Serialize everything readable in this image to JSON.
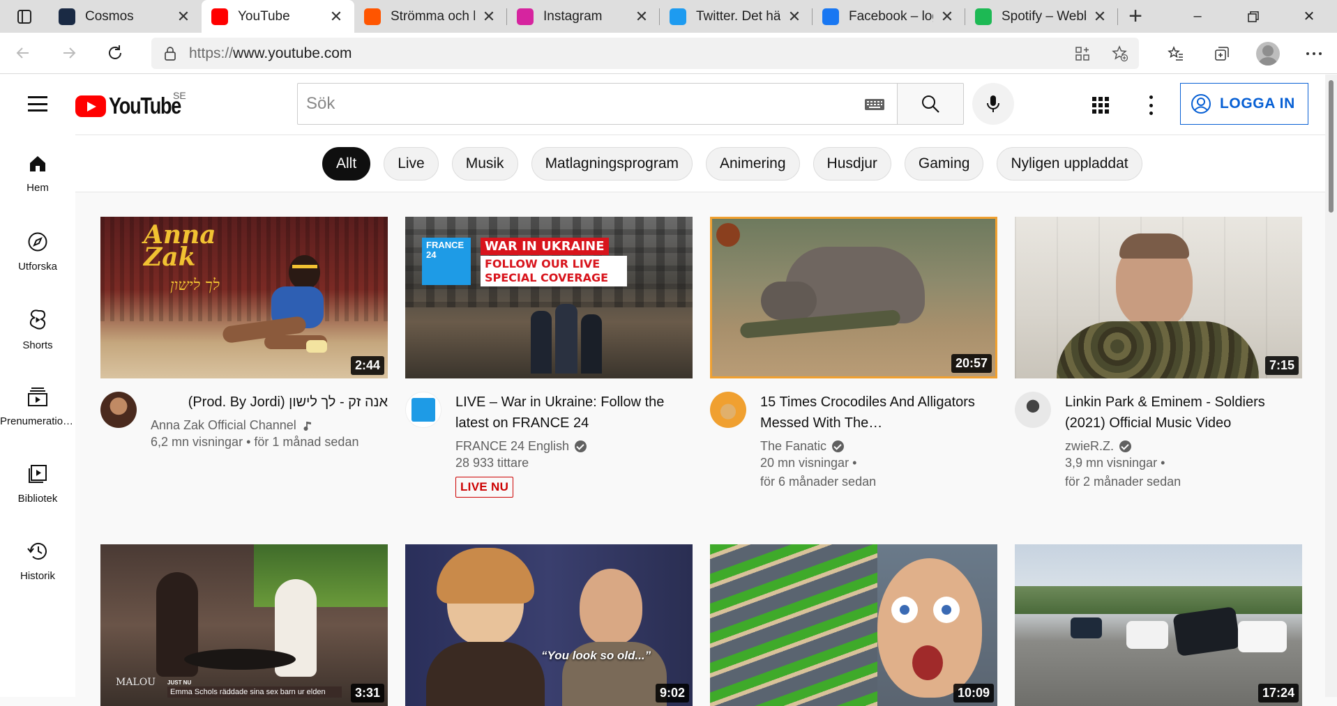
{
  "browser": {
    "tabs": [
      {
        "title": "Cosmos",
        "favicon": "cosmos-icon",
        "color": "#1a2a44"
      },
      {
        "title": "YouTube",
        "favicon": "youtube-icon",
        "color": "#ff0000"
      },
      {
        "title": "Strömma och ly",
        "favicon": "soundcloud-icon",
        "color": "#ff5500"
      },
      {
        "title": "Instagram",
        "favicon": "instagram-icon",
        "color": "#d6249f"
      },
      {
        "title": "Twitter. Det här",
        "favicon": "twitter-icon",
        "color": "#1d9bf0"
      },
      {
        "title": "Facebook – log",
        "favicon": "facebook-icon",
        "color": "#1877f2"
      },
      {
        "title": "Spotify – Webb",
        "favicon": "spotify-icon",
        "color": "#1db954"
      }
    ],
    "active_tab": 1,
    "url_protocol": "https://",
    "url_host": "www.youtube.com"
  },
  "youtube": {
    "logo_text": "YouTube",
    "country_code": "SE",
    "search_placeholder": "Sök",
    "login_label": "LOGGA IN",
    "sidebar": [
      {
        "label": "Hem",
        "icon": "home-icon"
      },
      {
        "label": "Utforska",
        "icon": "compass-icon"
      },
      {
        "label": "Shorts",
        "icon": "shorts-icon"
      },
      {
        "label": "Prenumerationer",
        "icon": "subscriptions-icon"
      },
      {
        "label": "Bibliotek",
        "icon": "library-icon"
      },
      {
        "label": "Historik",
        "icon": "history-icon"
      }
    ],
    "chips": [
      "Allt",
      "Live",
      "Musik",
      "Matlagningsprogram",
      "Animering",
      "Husdjur",
      "Gaming",
      "Nyligen uppladdat"
    ],
    "videos": [
      {
        "title": "אנה זק - לך לישון (Prod. By Jordi)",
        "channel": "Anna Zak Official Channel",
        "stats1": "6,2 mn visningar • för 1 månad sedan",
        "stats2": "",
        "duration": "2:44",
        "thumb_text": "Anna Zak",
        "thumb_subtext": "לך לישון",
        "music_note": true
      },
      {
        "title": "LIVE – War in Ukraine: Follow the latest on FRANCE 24",
        "channel": "FRANCE 24 English",
        "stats1": "28 933 tittare",
        "stats2": "",
        "live_label": "LIVE NU",
        "thumb_text": "WAR IN UKRAINE",
        "thumb_subtext": "FOLLOW OUR LIVE SPECIAL COVERAGE",
        "thumb_logo": "FRANCE 24",
        "verified": true
      },
      {
        "title": "15 Times Crocodiles And Alligators Messed With The…",
        "channel": "The Fanatic",
        "stats1": "20 mn visningar •",
        "stats2": "för 6 månader sedan",
        "duration": "20:57",
        "verified": true
      },
      {
        "title": "Linkin Park & Eminem - Soldiers (2021) Official Music Video",
        "channel": "zwieR.Z.",
        "stats1": "3,9 mn visningar •",
        "stats2": "för 2 månader sedan",
        "duration": "7:15",
        "verified": true
      },
      {
        "duration": "3:31",
        "thumb_text": "MALOU",
        "thumb_banner": "JUST NU",
        "thumb_caption": "Emma Schols räddade sina sex barn ur elden"
      },
      {
        "duration": "9:02",
        "thumb_caption": "“You look so old...”"
      },
      {
        "duration": "10:09"
      },
      {
        "duration": "17:24"
      }
    ]
  }
}
